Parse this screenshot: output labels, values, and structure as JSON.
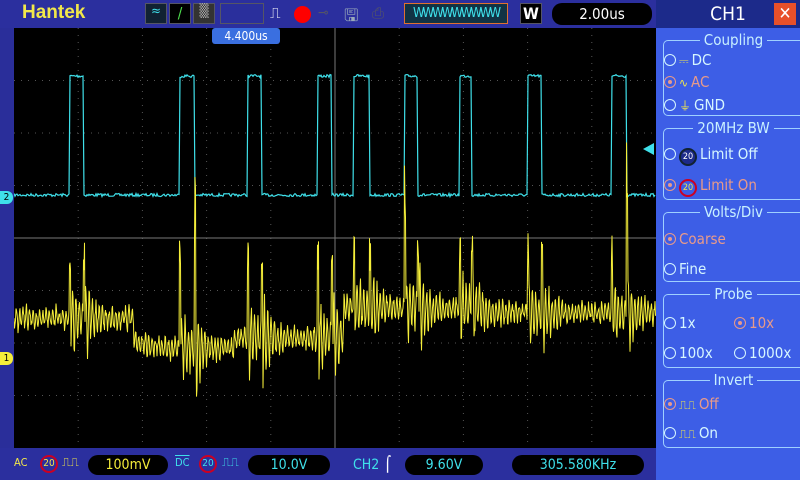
{
  "header": {
    "brand": "Hantek",
    "time_base": "2.00us",
    "window_mode": "W",
    "trigger_position": "4.400us"
  },
  "bottom": {
    "ch1_coupling": "AC",
    "ch1_bw": "20",
    "ch1_volts": "100mV",
    "ch2_coupling": "DC",
    "ch2_bw": "20",
    "ch2_volts": "10.0V",
    "trigger_source": "CH2",
    "trigger_level": "9.60V",
    "frequency": "305.580KHz"
  },
  "panel": {
    "title": "CH1",
    "coupling": {
      "title": "Coupling",
      "options": [
        "DC",
        "AC",
        "GND"
      ],
      "selected": "AC"
    },
    "bw": {
      "title": "20MHz BW",
      "options": [
        "Limit Off",
        "Limit On"
      ],
      "selected": "Limit On",
      "badge": "20"
    },
    "volts_div": {
      "title": "Volts/Div",
      "options": [
        "Coarse",
        "Fine"
      ],
      "selected": "Coarse"
    },
    "probe": {
      "title": "Probe",
      "options": [
        "1x",
        "10x",
        "100x",
        "1000x"
      ],
      "selected": "10x"
    },
    "invert": {
      "title": "Invert",
      "options": [
        "Off",
        "On"
      ],
      "selected": "Off"
    }
  },
  "markers": {
    "ch1": "1",
    "ch2": "2"
  },
  "colors": {
    "ch1": "#f5ee3a",
    "ch2": "#3fe0ea",
    "background": "#2b2f9e",
    "panel": "#3d5ee6"
  }
}
